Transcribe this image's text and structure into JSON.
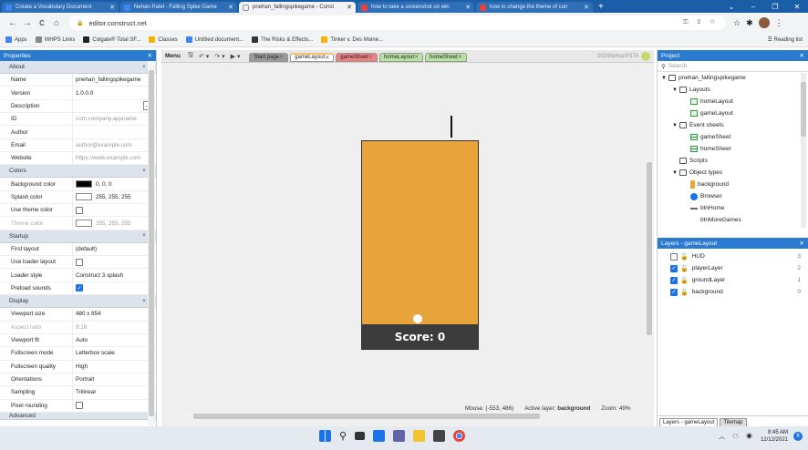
{
  "browser": {
    "tabs": [
      {
        "label": "Create a Vocabulary Document",
        "icon": "docs-icon",
        "color": "#4285f4"
      },
      {
        "label": "Nehan Patel - Falling Spike Game",
        "icon": "docs-icon",
        "color": "#4285f4"
      },
      {
        "label": "pnehan_fallingspikegame - Const",
        "icon": "construct-icon",
        "color": "#f0f0f0",
        "active": true
      },
      {
        "label": "how to take a screenshot on win",
        "icon": "google-icon",
        "color": "#ea4335"
      },
      {
        "label": "how to change the theme of con",
        "icon": "google-icon",
        "color": "#ea4335"
      }
    ],
    "new_tab": "+",
    "window_controls": [
      "⌄",
      "–",
      "❐",
      "✕"
    ],
    "url": "editor.construct.net",
    "nav": {
      "back": "←",
      "forward": "→",
      "reload": "C",
      "home": "⌂"
    },
    "bookmarks": [
      {
        "label": "Apps",
        "color": "#4285f4"
      },
      {
        "label": "WHPS Links",
        "color": "#888888"
      },
      {
        "label": "Colgate® Total SF...",
        "color": "#222222"
      },
      {
        "label": "Classes",
        "color": "#f4b400"
      },
      {
        "label": "Untitled document...",
        "color": "#4285f4"
      },
      {
        "label": "The Risks & Effects...",
        "color": "#333333"
      },
      {
        "label": "Tinker v. Des Moine...",
        "color": "#f4b400"
      }
    ],
    "reading_list": "Reading list"
  },
  "properties": {
    "title": "Properties",
    "sections": [
      {
        "name": "About",
        "rows": [
          {
            "key": "Name",
            "value": "pnehan_fallingspikegame"
          },
          {
            "key": "Version",
            "value": "1.0.0.0"
          },
          {
            "key": "Description",
            "value": "",
            "button": "..."
          },
          {
            "key": "ID",
            "value": "com.company.appname",
            "gray": true
          },
          {
            "key": "Author",
            "value": ""
          },
          {
            "key": "Email",
            "value": "author@example.com",
            "gray": true
          },
          {
            "key": "Website",
            "value": "https://www.example.com",
            "gray": true
          }
        ]
      },
      {
        "name": "Colors",
        "rows": [
          {
            "key": "Background color",
            "value": "0, 0, 0",
            "swatch": "#000000"
          },
          {
            "key": "Splash color",
            "value": "255, 255, 255",
            "swatch": "#ffffff"
          },
          {
            "key": "Use theme color",
            "checkbox": false
          },
          {
            "key": "Theme color",
            "value": "255, 255, 255",
            "swatch": "#ffffff",
            "gray": true,
            "keygray": true
          }
        ]
      },
      {
        "name": "Startup",
        "rows": [
          {
            "key": "First layout",
            "value": "(default)",
            "dropdown": true
          },
          {
            "key": "Use loader layout",
            "checkbox": false
          },
          {
            "key": "Loader style",
            "value": "Construct 3 splash",
            "dropdown": true
          },
          {
            "key": "Preload sounds",
            "checkbox": true
          }
        ]
      },
      {
        "name": "Display",
        "rows": [
          {
            "key": "Viewport size",
            "value": "480 x 854",
            "expander": true
          },
          {
            "key": "Aspect ratio",
            "value": "9:16",
            "gray": true,
            "keygray": true
          },
          {
            "key": "Viewport fit",
            "value": "Auto",
            "dropdown": true
          },
          {
            "key": "Fullscreen mode",
            "value": "Letterbox scale",
            "dropdown": true
          },
          {
            "key": "Fullscreen quality",
            "value": "High",
            "dropdown": true
          },
          {
            "key": "Orientations",
            "value": "Portrait",
            "dropdown": true
          },
          {
            "key": "Sampling",
            "value": "Trilinear",
            "dropdown": true
          },
          {
            "key": "Pixel rounding",
            "checkbox": false
          }
        ]
      }
    ],
    "next_section": "Advanced"
  },
  "editor": {
    "menu": "Menu",
    "tabs": [
      {
        "label": "Start page",
        "color": "#9a9a9a"
      },
      {
        "label": "gameLayout",
        "color": "#f7c56b",
        "active": true
      },
      {
        "label": "gameSheet",
        "color": "#f08080"
      },
      {
        "label": "homeLayout",
        "color": "#b5e3a0"
      },
      {
        "label": "homeSheet",
        "color": "#b5e3a0"
      }
    ],
    "project_version": "2024NehanP374",
    "score_text": "Score: 0",
    "status": {
      "mouse": "Mouse: (-553, 486)",
      "active_layer_label": "Active layer:",
      "active_layer": "background",
      "zoom": "Zoom: 49%"
    },
    "game_colors": {
      "background": "#e8a33a",
      "score_bar": "#3c3c3c"
    }
  },
  "project": {
    "title": "Project",
    "search_placeholder": "Search",
    "tree": [
      {
        "label": "pnehan_fallingspikegame",
        "depth": 0,
        "icon": "folder-icon",
        "expand": "▼"
      },
      {
        "label": "Layouts",
        "depth": 1,
        "icon": "folder-icon",
        "expand": "▼"
      },
      {
        "label": "homeLayout",
        "depth": 2,
        "icon": "layout-icon"
      },
      {
        "label": "gameLayout",
        "depth": 2,
        "icon": "layout-icon"
      },
      {
        "label": "Event sheets",
        "depth": 1,
        "icon": "folder-icon",
        "expand": "▼"
      },
      {
        "label": "gameSheet",
        "depth": 2,
        "icon": "event-sheet-icon"
      },
      {
        "label": "homeSheet",
        "depth": 2,
        "icon": "event-sheet-icon"
      },
      {
        "label": "Scripts",
        "depth": 1,
        "icon": "folder-icon"
      },
      {
        "label": "Object types",
        "depth": 1,
        "icon": "folder-icon",
        "expand": "▼"
      },
      {
        "label": "background",
        "depth": 2,
        "icon": "sprite-icon"
      },
      {
        "label": "Browser",
        "depth": 2,
        "icon": "globe-icon"
      },
      {
        "label": "btnHome",
        "depth": 2,
        "icon": "button-icon"
      },
      {
        "label": "btnMoreGames",
        "depth": 2,
        "icon": "none"
      }
    ]
  },
  "layers": {
    "title": "Layers - gameLayout",
    "rows": [
      {
        "name": "HUD",
        "visible": false,
        "index": "3"
      },
      {
        "name": "playerLayer",
        "visible": true,
        "index": "2"
      },
      {
        "name": "groundLayer",
        "visible": true,
        "index": "1"
      },
      {
        "name": "background",
        "visible": true,
        "index": "0"
      }
    ],
    "bottom_tabs": [
      "Layers - gameLayout",
      "Tilemap"
    ]
  },
  "taskbar": {
    "time": "8:45 AM",
    "date": "12/12/2021",
    "notifications": "6"
  }
}
